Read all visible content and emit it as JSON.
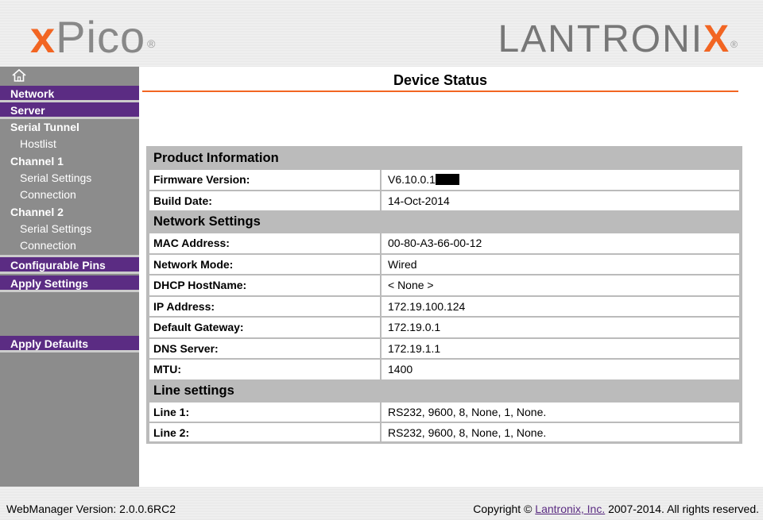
{
  "header": {
    "xpico_logo": {
      "x": "x",
      "rest": "Pico",
      "reg": "®"
    },
    "lantronix_logo": {
      "text": "LANTRONI",
      "x": "X",
      "reg": "®"
    }
  },
  "sidebar": {
    "home_icon": "home-icon",
    "items": [
      {
        "label": "Network"
      },
      {
        "label": "Server"
      },
      {
        "label": "Serial Tunnel"
      },
      {
        "label": "Hostlist"
      },
      {
        "label": "Channel 1"
      },
      {
        "label": "Serial Settings"
      },
      {
        "label": "Connection"
      },
      {
        "label": "Channel 2"
      },
      {
        "label": "Serial Settings"
      },
      {
        "label": "Connection"
      },
      {
        "label": "Configurable Pins"
      },
      {
        "label": "Apply Settings"
      },
      {
        "label": "Apply Defaults"
      }
    ]
  },
  "main": {
    "title": "Device Status",
    "sections": {
      "product": {
        "heading": "Product Information",
        "firmware_label": "Firmware Version:",
        "firmware_value": "V6.10.0.1",
        "build_label": "Build Date:",
        "build_value": "14-Oct-2014"
      },
      "network": {
        "heading": "Network Settings",
        "rows": [
          {
            "label": "MAC Address:",
            "value": "00-80-A3-66-00-12"
          },
          {
            "label": "Network Mode:",
            "value": "Wired"
          },
          {
            "label": "DHCP HostName:",
            "value": "< None >"
          },
          {
            "label": "IP Address:",
            "value": "172.19.100.124"
          },
          {
            "label": "Default Gateway:",
            "value": "172.19.0.1"
          },
          {
            "label": "DNS Server:",
            "value": "172.19.1.1"
          },
          {
            "label": "MTU:",
            "value": "1400"
          }
        ]
      },
      "line": {
        "heading": "Line settings",
        "rows": [
          {
            "label": "Line 1:",
            "value": "RS232, 9600, 8, None, 1, None."
          },
          {
            "label": "Line 2:",
            "value": "RS232, 9600, 8, None, 1, None."
          }
        ]
      }
    }
  },
  "footer": {
    "version": "WebManager Version: 2.0.0.6RC2",
    "copyright_prefix": "Copyright © ",
    "company_link": "Lantronix, Inc.",
    "copyright_suffix": " 2007-2014. All rights reserved."
  },
  "colors": {
    "brand_purple": "#5b2c83",
    "brand_orange": "#f26522",
    "sidebar_gray": "#8c8c8c",
    "table_gray": "#bbbbbb"
  }
}
